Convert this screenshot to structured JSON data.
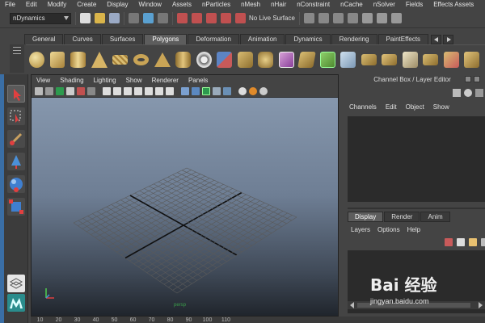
{
  "menubar": {
    "items": [
      "File",
      "Edit",
      "Modify",
      "Create",
      "Display",
      "Window",
      "Assets",
      "nParticles",
      "nMesh",
      "nHair",
      "nConstraint",
      "nCache",
      "nSolver",
      "Fields",
      "Effects Assets"
    ]
  },
  "statusline": {
    "mode": "nDynamics",
    "live_surface": "No Live Surface"
  },
  "shelf": {
    "tabs": [
      "General",
      "Curves",
      "Surfaces",
      "Polygons",
      "Deformation",
      "Animation",
      "Dynamics",
      "Rendering",
      "PaintEffects"
    ],
    "active_tab": "Polygons",
    "tools": [
      "poly-sphere-icon",
      "poly-cube-icon",
      "poly-cylinder-icon",
      "poly-cone-icon",
      "poly-plane-icon",
      "poly-torus-icon",
      "poly-pyramid-icon",
      "poly-pipe-icon",
      "poly-soccer-ball-icon",
      "combine-icon",
      "separate-icon",
      "smooth-icon",
      "boolean-icon",
      "extrude-icon",
      "bridge-icon",
      "append-polygon-icon",
      "split-polygon-icon",
      "insert-edge-loop-icon",
      "bevel-icon",
      "merge-icon",
      "extract-icon",
      "wedge-icon"
    ]
  },
  "toolbox": {
    "tools": [
      "select-tool-icon",
      "lasso-tool-icon",
      "paint-select-icon",
      "move-tool-icon",
      "rotate-tool-icon",
      "scale-tool-icon",
      "layout-icon",
      "maya-logo-icon"
    ]
  },
  "viewport": {
    "menu": [
      "View",
      "Shading",
      "Lighting",
      "Show",
      "Renderer",
      "Panels"
    ],
    "camera_label": "persp",
    "axis_x": "x",
    "axis_y": "y"
  },
  "channel_box": {
    "title": "Channel Box / Layer Editor",
    "menu": [
      "Channels",
      "Edit",
      "Object",
      "Show"
    ]
  },
  "layer_editor": {
    "tabs": [
      "Display",
      "Render",
      "Anim"
    ],
    "active_tab": "Display",
    "menu": [
      "Layers",
      "Options",
      "Help"
    ]
  },
  "timeline": {
    "ticks": [
      "10",
      "20",
      "30",
      "40",
      "50",
      "60",
      "70",
      "80",
      "90",
      "100",
      "110"
    ]
  },
  "watermark": {
    "brand": "Bai 经验",
    "url": "jingyan.baidu.com"
  },
  "colors": {
    "accent": "#3a6ea5",
    "panel": "#444444",
    "dark": "#2b2b2b"
  }
}
